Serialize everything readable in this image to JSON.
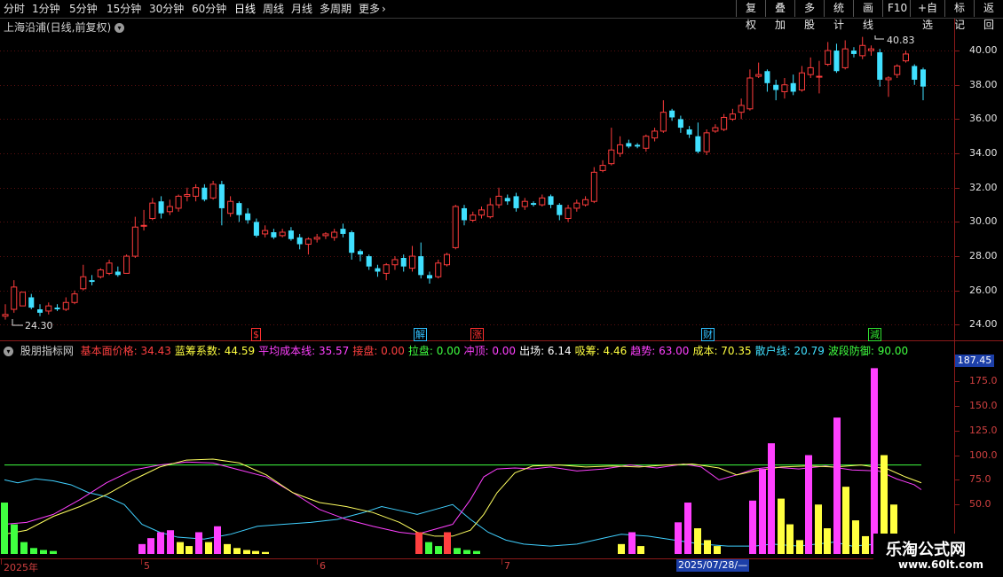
{
  "toolbar": {
    "periods": [
      "分时",
      "1分钟",
      "5分钟",
      "15分钟",
      "30分钟",
      "60分钟",
      "日线",
      "周线",
      "月线",
      "多周期",
      "更多"
    ],
    "active_period": "日线",
    "buttons": [
      "复权",
      "叠加",
      "多股",
      "统计",
      "画线",
      "F10",
      "+自选",
      "标记",
      "返回"
    ]
  },
  "stock": {
    "title": "上海沿浦(日线,前复权)"
  },
  "price_axis": {
    "labels": [
      "40.00",
      "38.00",
      "36.00",
      "34.00",
      "32.00",
      "30.00",
      "28.00",
      "26.00",
      "24.00"
    ]
  },
  "annotations": {
    "high": "40.83",
    "low": "24.30"
  },
  "markers": [
    {
      "text": "$",
      "color": "#ff3030"
    },
    {
      "text": "解",
      "color": "#30c0ff"
    },
    {
      "text": "涨",
      "color": "#ff3030"
    },
    {
      "text": "财",
      "color": "#30c0ff"
    },
    {
      "text": "減",
      "color": "#30e030"
    }
  ],
  "indicator": {
    "name": "股朋指标网",
    "fields": [
      {
        "label": "基本面价格:",
        "value": "34.43",
        "color": "#ff4040"
      },
      {
        "label": "蓝筹系数:",
        "value": "44.59",
        "color": "#ffff40"
      },
      {
        "label": "平均成本线:",
        "value": "35.57",
        "color": "#ff40ff"
      },
      {
        "label": "接盘:",
        "value": "0.00",
        "color": "#ff4040"
      },
      {
        "label": "拉盘:",
        "value": "0.00",
        "color": "#40ff40"
      },
      {
        "label": "冲顶:",
        "value": "0.00",
        "color": "#ff40ff"
      },
      {
        "label": "出场:",
        "value": "6.14",
        "color": "#ffffff"
      },
      {
        "label": "吸筹:",
        "value": "4.46",
        "color": "#ffff40"
      },
      {
        "label": "趋势:",
        "value": "63.00",
        "color": "#ff40ff"
      },
      {
        "label": "成本:",
        "value": "70.35",
        "color": "#ffff40"
      },
      {
        "label": "散户线:",
        "value": "20.79",
        "color": "#40e0ff"
      },
      {
        "label": "波段防御:",
        "value": "90.00",
        "color": "#40ff40"
      }
    ],
    "axis_labels": [
      "175.0",
      "150.0",
      "125.0",
      "100.0",
      "75.0",
      "50.0"
    ],
    "current_value": "187.45"
  },
  "dates": {
    "labels": [
      "2025年",
      "5",
      "6",
      "7"
    ],
    "cursor": "2025/07/28/—"
  },
  "watermark": {
    "top": "乐淘公式网",
    "bottom": "www.60lt.com"
  },
  "colors": {
    "up": "#ff3c3c",
    "down": "#40e0ff",
    "grid": "#5a1010",
    "axis": "#8b1a1a"
  },
  "chart_data": {
    "type": "candlestick",
    "ylim": [
      23.4,
      41.4
    ],
    "candles": [
      [
        24.5,
        24.6,
        24.3,
        25.2
      ],
      [
        24.9,
        26.2,
        24.7,
        26.6
      ],
      [
        25.1,
        25.9,
        25.2,
        25.8
      ],
      [
        25.6,
        25.0,
        24.9,
        25.8
      ],
      [
        24.9,
        24.7,
        24.5,
        25.2
      ],
      [
        24.8,
        25.1,
        24.6,
        25.3
      ],
      [
        25.0,
        24.9,
        24.8,
        25.2
      ],
      [
        24.9,
        25.3,
        24.8,
        25.6
      ],
      [
        25.3,
        25.8,
        25.2,
        26.0
      ],
      [
        26.1,
        26.8,
        26.0,
        27.5
      ],
      [
        26.6,
        26.5,
        26.3,
        26.9
      ],
      [
        26.8,
        27.2,
        26.7,
        27.3
      ],
      [
        27.0,
        27.6,
        26.9,
        27.8
      ],
      [
        27.1,
        26.9,
        26.8,
        27.4
      ],
      [
        27.0,
        28.0,
        27.0,
        28.1
      ],
      [
        28.0,
        29.7,
        27.9,
        30.3
      ],
      [
        29.8,
        29.8,
        29.5,
        30.7
      ],
      [
        30.2,
        31.1,
        30.1,
        31.4
      ],
      [
        31.2,
        30.5,
        30.2,
        31.5
      ],
      [
        30.6,
        30.9,
        30.4,
        31.3
      ],
      [
        30.8,
        31.5,
        30.6,
        31.6
      ],
      [
        31.5,
        31.6,
        31.2,
        32.0
      ],
      [
        31.5,
        32.0,
        31.2,
        32.2
      ],
      [
        32.0,
        31.3,
        31.2,
        32.2
      ],
      [
        31.4,
        32.2,
        31.3,
        32.4
      ],
      [
        32.2,
        30.8,
        29.8,
        32.4
      ],
      [
        30.5,
        31.2,
        30.3,
        31.5
      ],
      [
        31.1,
        30.4,
        30.0,
        31.2
      ],
      [
        30.5,
        30.1,
        29.9,
        30.8
      ],
      [
        30.0,
        29.2,
        29.1,
        30.2
      ],
      [
        29.3,
        29.5,
        29.1,
        29.8
      ],
      [
        29.4,
        29.1,
        29.0,
        29.6
      ],
      [
        29.2,
        29.4,
        29.1,
        29.6
      ],
      [
        29.5,
        29.0,
        28.9,
        29.7
      ],
      [
        29.1,
        28.7,
        28.4,
        29.3
      ],
      [
        28.7,
        29.0,
        28.1,
        29.1
      ],
      [
        29.0,
        29.1,
        28.8,
        29.3
      ],
      [
        29.2,
        29.3,
        29.0,
        29.4
      ],
      [
        29.1,
        29.4,
        28.9,
        29.6
      ],
      [
        29.6,
        29.3,
        29.1,
        29.9
      ],
      [
        29.4,
        28.2,
        27.8,
        29.5
      ],
      [
        28.3,
        28.1,
        27.7,
        28.4
      ],
      [
        28.0,
        27.4,
        27.2,
        28.1
      ],
      [
        27.3,
        27.1,
        26.8,
        27.5
      ],
      [
        27.0,
        27.5,
        26.6,
        27.6
      ],
      [
        27.5,
        27.8,
        27.2,
        28.0
      ],
      [
        27.9,
        27.4,
        27.1,
        28.1
      ],
      [
        27.3,
        28.0,
        27.1,
        28.6
      ],
      [
        28.0,
        26.9,
        26.7,
        28.8
      ],
      [
        26.9,
        26.7,
        26.4,
        27.1
      ],
      [
        26.8,
        27.6,
        26.7,
        27.8
      ],
      [
        27.5,
        28.1,
        27.4,
        28.2
      ],
      [
        28.5,
        30.9,
        28.4,
        31.0
      ],
      [
        30.8,
        30.1,
        29.8,
        31.0
      ],
      [
        30.1,
        30.4,
        30.0,
        30.6
      ],
      [
        30.4,
        30.7,
        30.2,
        30.9
      ],
      [
        30.3,
        31.0,
        30.2,
        31.4
      ],
      [
        31.0,
        31.5,
        30.8,
        32.0
      ],
      [
        31.4,
        31.2,
        31.0,
        31.6
      ],
      [
        31.5,
        30.8,
        30.6,
        31.7
      ],
      [
        30.9,
        31.2,
        30.7,
        31.4
      ],
      [
        31.1,
        31.0,
        30.9,
        31.2
      ],
      [
        31.0,
        31.4,
        30.9,
        31.6
      ],
      [
        31.5,
        31.0,
        30.8,
        31.6
      ],
      [
        31.0,
        30.4,
        30.1,
        31.1
      ],
      [
        30.2,
        30.8,
        30.0,
        31.0
      ],
      [
        30.8,
        31.1,
        30.6,
        31.3
      ],
      [
        31.0,
        31.3,
        30.9,
        31.5
      ],
      [
        31.2,
        32.9,
        31.1,
        33.2
      ],
      [
        33.0,
        33.3,
        32.9,
        33.6
      ],
      [
        33.4,
        34.2,
        33.3,
        35.5
      ],
      [
        34.0,
        34.5,
        33.8,
        35.0
      ],
      [
        34.6,
        34.4,
        34.3,
        34.8
      ],
      [
        34.5,
        34.4,
        34.3,
        34.6
      ],
      [
        34.3,
        35.0,
        34.1,
        35.1
      ],
      [
        34.9,
        35.3,
        34.7,
        35.5
      ],
      [
        35.3,
        36.4,
        35.2,
        37.1
      ],
      [
        36.5,
        36.1,
        35.9,
        36.6
      ],
      [
        36.0,
        35.5,
        35.2,
        36.2
      ],
      [
        35.4,
        35.1,
        34.9,
        35.6
      ],
      [
        35.0,
        34.1,
        34.0,
        35.8
      ],
      [
        34.1,
        35.2,
        33.9,
        35.4
      ],
      [
        35.3,
        35.5,
        35.2,
        35.7
      ],
      [
        35.4,
        36.1,
        35.3,
        36.3
      ],
      [
        36.0,
        36.3,
        35.9,
        36.6
      ],
      [
        36.4,
        36.8,
        36.0,
        37.2
      ],
      [
        36.6,
        38.4,
        36.5,
        38.9
      ],
      [
        38.5,
        38.6,
        38.4,
        39.3
      ],
      [
        38.8,
        38.1,
        37.6,
        38.9
      ],
      [
        38.0,
        37.7,
        37.1,
        38.3
      ],
      [
        37.6,
        38.0,
        37.2,
        38.4
      ],
      [
        38.1,
        37.6,
        37.4,
        38.6
      ],
      [
        37.7,
        38.7,
        37.6,
        39.1
      ],
      [
        38.6,
        39.0,
        38.4,
        39.6
      ],
      [
        38.5,
        38.5,
        37.5,
        39.4
      ],
      [
        39.2,
        40.0,
        39.1,
        40.5
      ],
      [
        40.0,
        38.8,
        38.7,
        40.4
      ],
      [
        39.0,
        40.1,
        38.9,
        40.6
      ],
      [
        40.0,
        39.8,
        39.6,
        40.2
      ],
      [
        39.7,
        40.3,
        39.5,
        40.8
      ],
      [
        40.0,
        40.1,
        39.7,
        40.3
      ],
      [
        39.9,
        38.3,
        37.9,
        40.1
      ],
      [
        38.3,
        38.4,
        37.3,
        38.5
      ],
      [
        38.6,
        39.1,
        38.4,
        39.2
      ],
      [
        39.4,
        39.8,
        39.3,
        40.0
      ],
      [
        39.1,
        38.3,
        38.0,
        39.2
      ],
      [
        38.9,
        37.9,
        37.1,
        39.0
      ]
    ]
  }
}
